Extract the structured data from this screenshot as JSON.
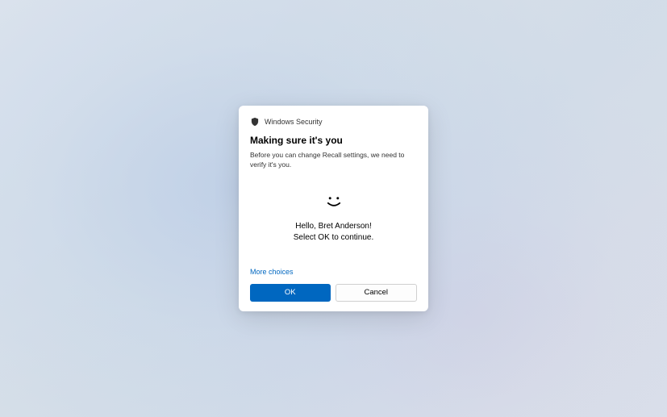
{
  "dialog": {
    "app_title": "Windows Security",
    "heading": "Making sure it's you",
    "subtext": "Before you can change Recall settings, we need to verify it's you.",
    "greeting_line1": "Hello, Bret Anderson!",
    "greeting_line2": "Select OK to continue.",
    "more_choices": "More choices",
    "ok_label": "OK",
    "cancel_label": "Cancel"
  },
  "colors": {
    "primary": "#0067c0",
    "background": "#ffffff"
  }
}
